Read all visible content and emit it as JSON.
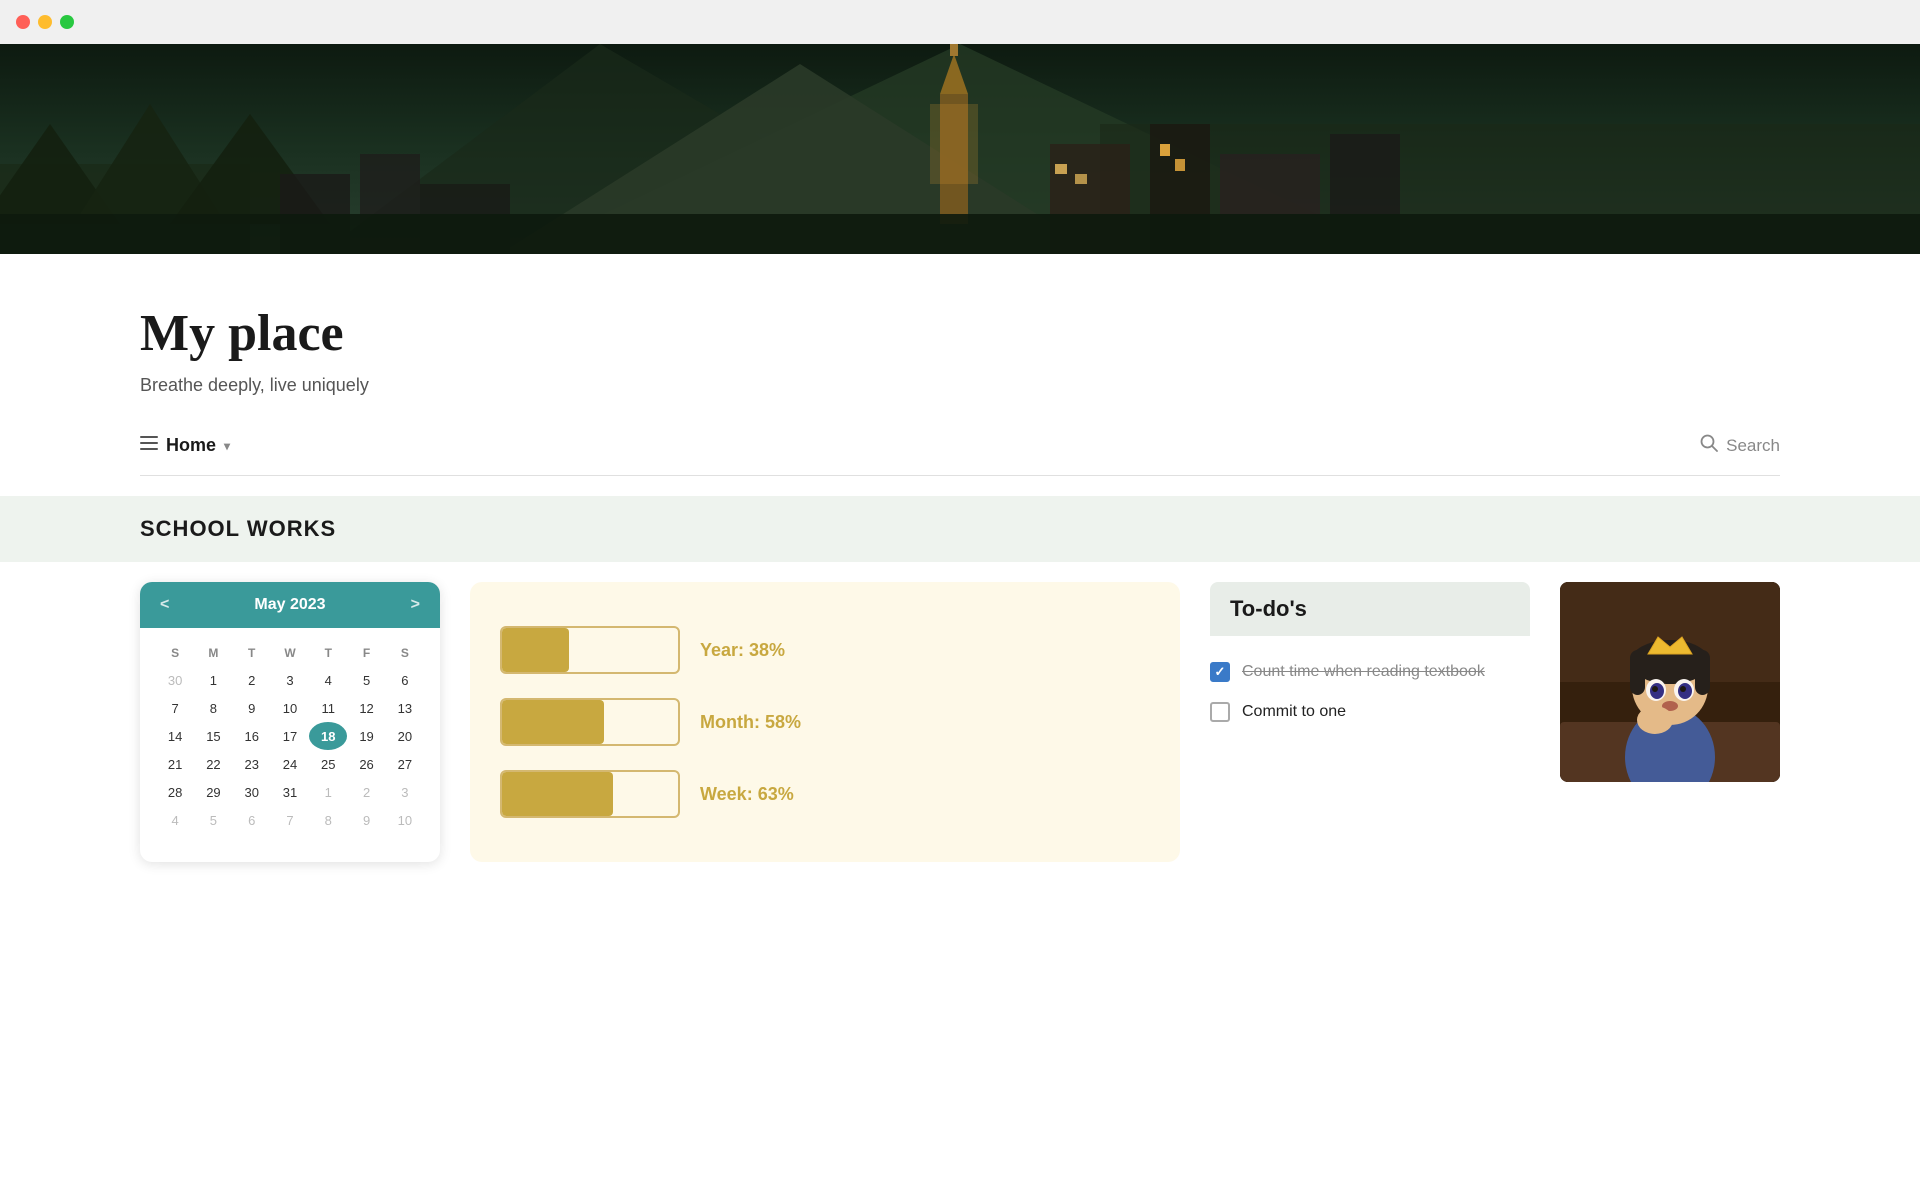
{
  "window": {
    "traffic_lights": {
      "red": "red",
      "yellow": "yellow",
      "green": "green"
    }
  },
  "hero": {
    "alt": "Mountain village with church tower at dusk"
  },
  "page": {
    "title": "My place",
    "subtitle": "Breathe deeply, live uniquely"
  },
  "nav": {
    "home_label": "Home",
    "home_icon": "≡",
    "chevron": "∨",
    "search_icon": "🔍",
    "search_label": "Search"
  },
  "section": {
    "title": "SCHOOL WORKS"
  },
  "calendar": {
    "month_year": "May 2023",
    "prev_label": "<",
    "next_label": ">",
    "day_headers": [
      "S",
      "M",
      "T",
      "W",
      "T",
      "F",
      "S"
    ],
    "weeks": [
      [
        "30",
        "1",
        "2",
        "3",
        "4",
        "5",
        "6"
      ],
      [
        "7",
        "8",
        "9",
        "10",
        "11",
        "12",
        "13"
      ],
      [
        "14",
        "15",
        "16",
        "17",
        "18",
        "19",
        "20"
      ],
      [
        "21",
        "22",
        "23",
        "24",
        "25",
        "26",
        "27"
      ],
      [
        "28",
        "29",
        "30",
        "31",
        "1",
        "2",
        "3"
      ],
      [
        "4",
        "5",
        "6",
        "7",
        "8",
        "9",
        "10"
      ]
    ],
    "today": "18",
    "other_month_start": [
      "30"
    ],
    "other_month_end": [
      "1",
      "2",
      "3",
      "4",
      "5",
      "6",
      "7",
      "8",
      "9",
      "10"
    ]
  },
  "progress": {
    "items": [
      {
        "label": "Year: 38%",
        "value": 38
      },
      {
        "label": "Month: 58%",
        "value": 58
      },
      {
        "label": "Week: 63%",
        "value": 63
      }
    ]
  },
  "todo": {
    "title": "To-do's",
    "items": [
      {
        "id": 1,
        "checked": true,
        "text": "Count time when reading textbook"
      },
      {
        "id": 2,
        "checked": false,
        "text": "Commit to one"
      }
    ]
  },
  "image": {
    "alt": "Anime character thinking with crown"
  }
}
